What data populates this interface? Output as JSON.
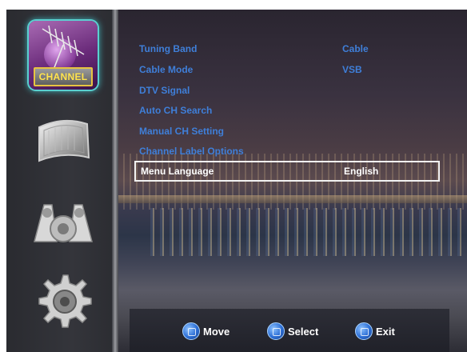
{
  "sidebar": {
    "items": [
      {
        "label": "CHANNEL",
        "icon": "antenna-icon",
        "active": true
      },
      {
        "label": "",
        "icon": "picture-icon",
        "active": false
      },
      {
        "label": "",
        "icon": "sound-icon",
        "active": false
      },
      {
        "label": "",
        "icon": "gear-icon",
        "active": false
      }
    ]
  },
  "menu": {
    "rows": [
      {
        "label": "Tuning Band",
        "value": "Cable"
      },
      {
        "label": "Cable Mode",
        "value": "VSB"
      },
      {
        "label": "DTV Signal",
        "value": ""
      },
      {
        "label": "Auto CH Search",
        "value": ""
      },
      {
        "label": "Manual CH Setting",
        "value": ""
      },
      {
        "label": "Channel Label Options",
        "value": ""
      },
      {
        "label": "Menu Language",
        "value": "English",
        "selected": true
      }
    ]
  },
  "hints": {
    "move": "Move",
    "select": "Select",
    "exit": "Exit"
  },
  "colors": {
    "menu_text": "#3f7fd9",
    "selected_text": "#ffffff",
    "channel_label": "#ffe34d",
    "highlight": "#5ad0d0"
  }
}
